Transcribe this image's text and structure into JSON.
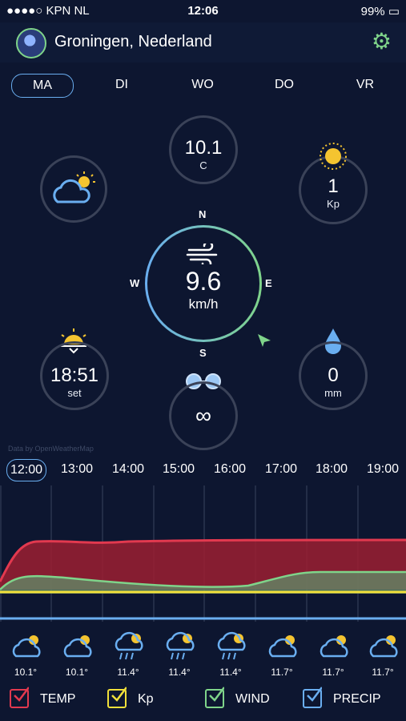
{
  "status_bar": {
    "carrier": "●●●●○ KPN NL",
    "time": "12:06",
    "battery": "99%"
  },
  "header": {
    "city": "Groningen, Nederland"
  },
  "days": [
    "MA",
    "DI",
    "WO",
    "DO",
    "VR"
  ],
  "weather": {
    "temperature": {
      "value": "10.1",
      "unit": "C"
    },
    "kp": {
      "value": "1",
      "unit": "Kp"
    },
    "wind": {
      "value": "9.6",
      "unit": "km/h",
      "compass": {
        "n": "N",
        "e": "E",
        "s": "S",
        "w": "W"
      }
    },
    "sunset": {
      "time": "18:51",
      "label": "set"
    },
    "visibility": {
      "value": "∞"
    },
    "precip": {
      "value": "0",
      "unit": "mm"
    }
  },
  "source": "Data by OpenWeatherMap",
  "hours": [
    "12:00",
    "13:00",
    "14:00",
    "15:00",
    "16:00",
    "17:00",
    "18:00",
    "19:00"
  ],
  "forecast_temps": [
    "10.1°",
    "10.1°",
    "11.4°",
    "11.4°",
    "11.4°",
    "11.7°",
    "11.7°",
    "11.7°"
  ],
  "legend": {
    "temp": "TEMP",
    "kp": "Kp",
    "wind": "WIND",
    "precip": "PRECIP"
  },
  "colors": {
    "temp": "#e2394f",
    "kp": "#f1e03a",
    "wind": "#7fd48a",
    "precip": "#6aaef0"
  }
}
